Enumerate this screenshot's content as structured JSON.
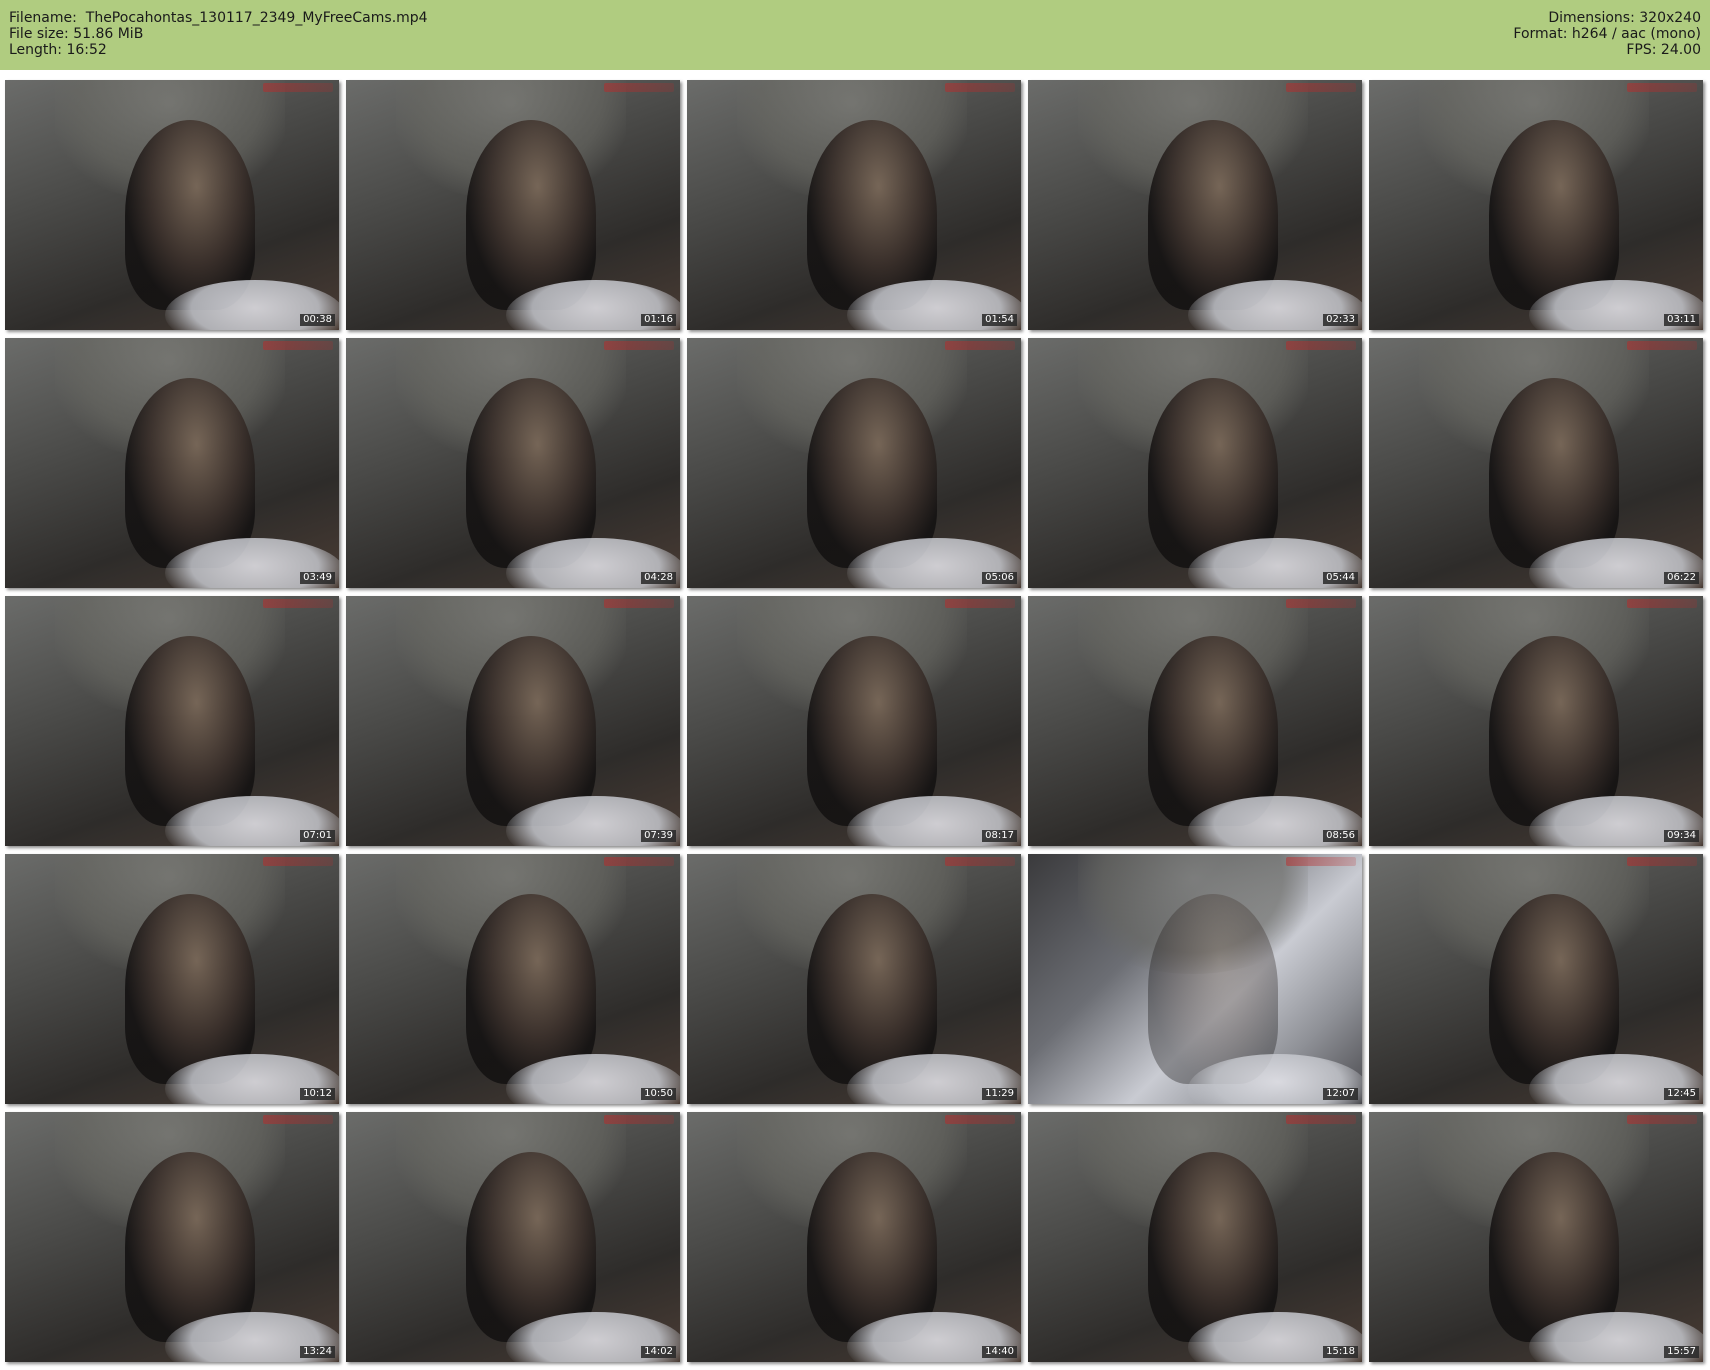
{
  "header": {
    "filename_label": "Filename:",
    "filename": "ThePocahontas_130117_2349_MyFreeCams.mp4",
    "filesize_label": "File size:",
    "filesize": "51.86 MiB",
    "length_label": "Length:",
    "length": "16:52",
    "dimensions_label": "Dimensions:",
    "dimensions": "320x240",
    "format_label": "Format:",
    "format": "h264 / aac (mono)",
    "fps_label": "FPS:",
    "fps": "24.00"
  },
  "thumbnails": [
    {
      "time": "00:38"
    },
    {
      "time": "01:16"
    },
    {
      "time": "01:54"
    },
    {
      "time": "02:33"
    },
    {
      "time": "03:11"
    },
    {
      "time": "03:49"
    },
    {
      "time": "04:28"
    },
    {
      "time": "05:06"
    },
    {
      "time": "05:44"
    },
    {
      "time": "06:22"
    },
    {
      "time": "07:01"
    },
    {
      "time": "07:39"
    },
    {
      "time": "08:17"
    },
    {
      "time": "08:56"
    },
    {
      "time": "09:34"
    },
    {
      "time": "10:12"
    },
    {
      "time": "10:50"
    },
    {
      "time": "11:29"
    },
    {
      "time": "12:07"
    },
    {
      "time": "12:45"
    },
    {
      "time": "13:24"
    },
    {
      "time": "14:02"
    },
    {
      "time": "14:40"
    },
    {
      "time": "15:18"
    },
    {
      "time": "15:57"
    }
  ]
}
